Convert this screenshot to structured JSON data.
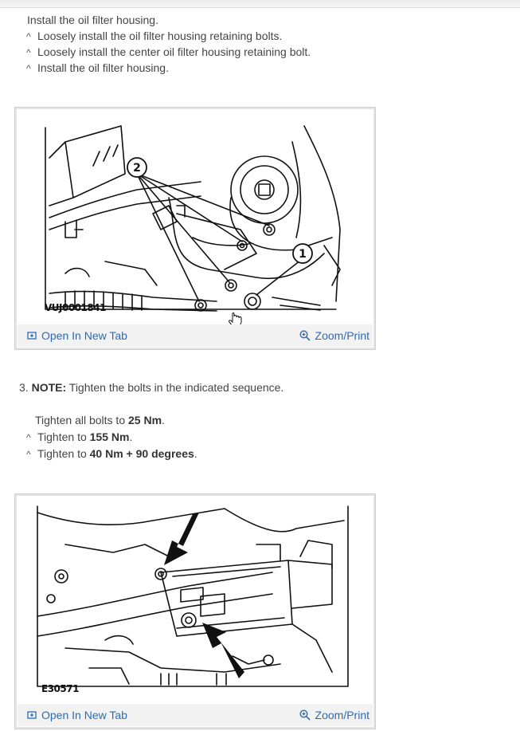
{
  "step2": {
    "intro": "Install the oil filter housing.",
    "bullets": [
      "Loosely install the oil filter housing retaining bolts.",
      "Loosely install the center oil filter housing retaining bolt.",
      "Install the oil filter housing."
    ]
  },
  "figure1": {
    "label": "VUJ0001841",
    "callouts": [
      "2",
      "1"
    ],
    "open_tab": "Open In New Tab",
    "zoom": "Zoom/Print"
  },
  "step3": {
    "number": "3.",
    "note_label": "NOTE:",
    "note_text": "Tighten the bolts in the indicated sequence.",
    "tighten_all_prefix": "Tighten all bolts to ",
    "tighten_all_value": "25 Nm",
    "tighten_all_suffix": ".",
    "b1_prefix": "Tighten to ",
    "b1_value": "155 Nm",
    "b1_suffix": ".",
    "b2_prefix": "Tighten to ",
    "b2_value": "40 Nm + 90 degrees",
    "b2_suffix": "."
  },
  "figure2": {
    "label": "E30571",
    "open_tab": "Open In New Tab",
    "zoom": "Zoom/Print"
  },
  "bullet_glyph": "^"
}
